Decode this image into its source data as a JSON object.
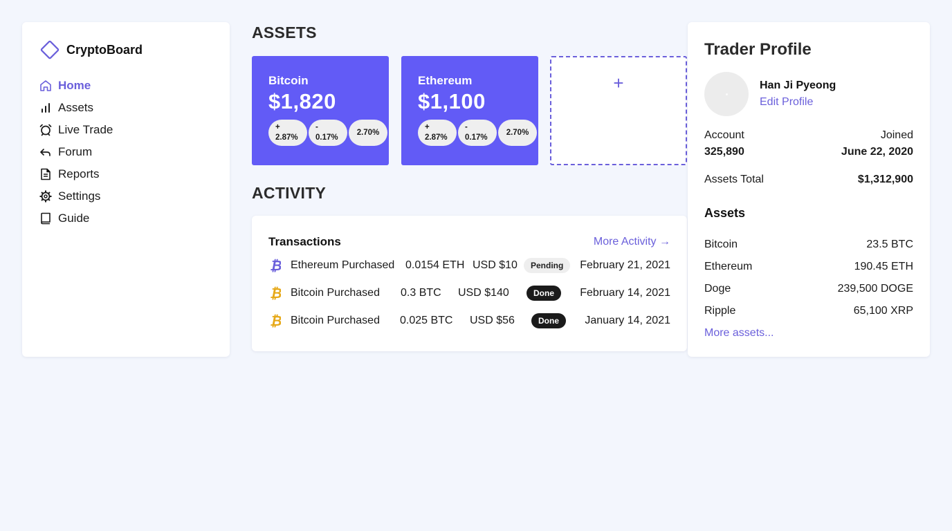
{
  "brand": {
    "name": "CryptoBoard",
    "accent": "#6a5fdb"
  },
  "nav": [
    {
      "label": "Home",
      "icon": "home-icon",
      "active": true
    },
    {
      "label": "Assets",
      "icon": "bar-chart-icon"
    },
    {
      "label": "Live Trade",
      "icon": "alarm-icon"
    },
    {
      "label": "Forum",
      "icon": "reply-icon"
    },
    {
      "label": "Reports",
      "icon": "document-icon"
    },
    {
      "label": "Settings",
      "icon": "gear-icon"
    },
    {
      "label": "Guide",
      "icon": "book-icon"
    }
  ],
  "assets_section": {
    "title": "ASSETS",
    "cards": [
      {
        "name": "Bitcoin",
        "price": "$1,820",
        "pills": [
          [
            "+",
            "2.87%"
          ],
          [
            "-",
            "0.17%"
          ],
          [
            "2.70%"
          ]
        ]
      },
      {
        "name": "Ethereum",
        "price": "$1,100",
        "pills": [
          [
            "+",
            "2.87%"
          ],
          [
            "-",
            "0.17%"
          ],
          [
            "2.70%"
          ]
        ]
      }
    ],
    "add_label": "+",
    "card_color": "#625bf6"
  },
  "activity": {
    "title": "ACTIVITY",
    "card_title": "Transactions",
    "more_label": "More Activity →",
    "rows": [
      {
        "icon": "bitcoin-purple-icon",
        "desc": "Ethereum Purchased",
        "amount": "0.0154 ETH",
        "usd": "USD $10",
        "status": "Pending",
        "date": "February 21, 2021"
      },
      {
        "icon": "bitcoin-gold-icon",
        "desc": "Bitcoin Purchased",
        "amount": "0.3 BTC",
        "usd": "USD $140",
        "status": "Done",
        "date": "February 14, 2021"
      },
      {
        "icon": "bitcoin-gold-icon",
        "desc": "Bitcoin Purchased",
        "amount": "0.025 BTC",
        "usd": "USD $56",
        "status": "Done",
        "date": "January 14, 2021"
      }
    ]
  },
  "profile": {
    "title": "Trader Profile",
    "name": "Han Ji Pyeong",
    "edit_label": "Edit Profile",
    "account_label": "Account",
    "account_value": "325,890",
    "joined_label": "Joined",
    "joined_value": "June 22, 2020",
    "assets_total_label": "Assets Total",
    "assets_total_value": "$1,312,900",
    "assets_heading": "Assets",
    "holdings": [
      {
        "name": "Bitcoin",
        "value": "23.5 BTC"
      },
      {
        "name": "Ethereum",
        "value": "190.45 ETH"
      },
      {
        "name": "Doge",
        "value": "239,500 DOGE"
      },
      {
        "name": "Ripple",
        "value": "65,100 XRP"
      }
    ],
    "more_assets": "More assets..."
  }
}
